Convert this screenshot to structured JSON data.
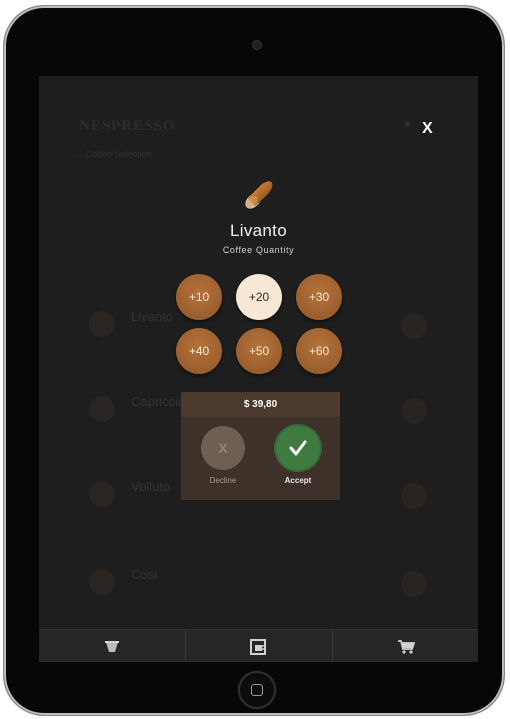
{
  "background": {
    "brand": "NESPRESSO",
    "breadcrumb": "←  Coffee Selection",
    "rows": [
      {
        "name": "Livanto"
      },
      {
        "name": "Capriccio"
      },
      {
        "name": "Volluto"
      },
      {
        "name": "Cosi"
      }
    ]
  },
  "dialog": {
    "close_label": "X",
    "product_name": "Livanto",
    "subtitle": "Coffee Quantity",
    "quantities": [
      "+10",
      "+20",
      "+30",
      "+40",
      "+50",
      "+60"
    ],
    "selected_quantity": "+20",
    "price": "$ 39,80",
    "decline_label": "Decline",
    "decline_symbol": "X",
    "accept_label": "Accept"
  },
  "bottom_nav": {
    "icons": [
      "coffee-pod-icon",
      "coffee-machine-icon",
      "cart-icon"
    ]
  },
  "colors": {
    "accent_brown": "#a5652f",
    "selected_quantity": "#f7e8d5",
    "accept_green": "#3f7a41",
    "offer_panel": "#3d3129"
  }
}
